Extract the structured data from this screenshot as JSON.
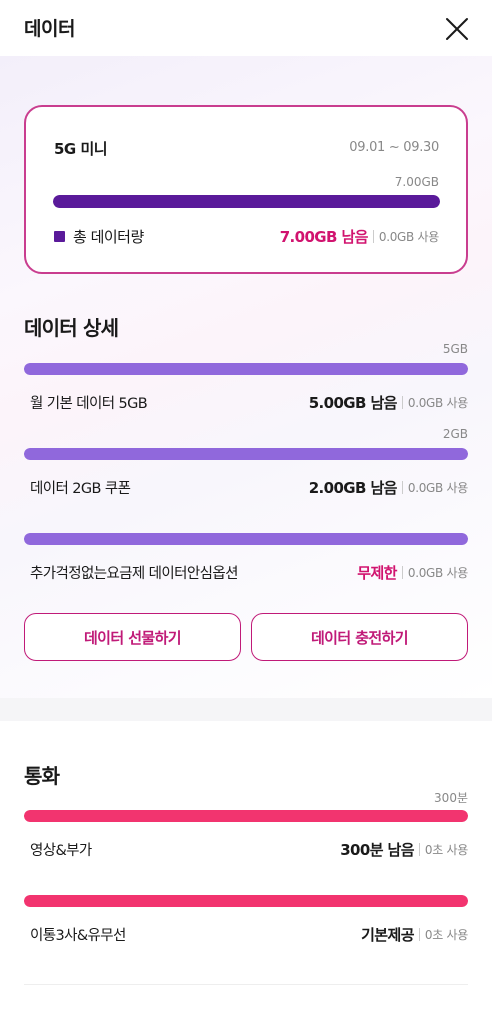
{
  "header": {
    "title": "데이터"
  },
  "plan": {
    "name": "5G 미니",
    "period": "09.01 ~ 09.30",
    "total": "7.00GB",
    "remaining_ratio": 1.0,
    "legend_label": "총 데이터량",
    "remaining": "7.00GB 남음",
    "used": "0.0GB 사용",
    "bar_color": "#5a1a9a"
  },
  "data_detail": {
    "title": "데이터 상세",
    "rows": [
      {
        "total": "5GB",
        "label": "월 기본 데이터 5GB",
        "remaining": "5.00GB 남음",
        "used": "0.0GB 사용",
        "remaining_ratio": 1.0
      },
      {
        "total": "2GB",
        "label": "데이터 2GB 쿠폰",
        "remaining": "2.00GB 남음",
        "used": "0.0GB 사용",
        "remaining_ratio": 1.0
      },
      {
        "total": "",
        "label": "추가걱정없는요금제 데이터안심옵션",
        "remaining": "무제한",
        "used": "0.0GB 사용",
        "remaining_ratio": 1.0
      }
    ],
    "gift_button": "데이터 선물하기",
    "charge_button": "데이터 충전하기"
  },
  "call": {
    "title": "통화",
    "rows": [
      {
        "total": "300분",
        "label": "영상&부가",
        "remaining": "300분 남음",
        "used": "0초 사용",
        "remaining_ratio": 1.0
      },
      {
        "total": "",
        "label": "이통3사&유무선",
        "remaining": "기본제공",
        "used": "0초 사용",
        "remaining_ratio": 1.0
      }
    ]
  },
  "colors": {
    "accent_pink": "#d1136f",
    "data_bar": "#9068dc",
    "call_bar": "#f2346f",
    "plan_border": "#c93d8f"
  }
}
